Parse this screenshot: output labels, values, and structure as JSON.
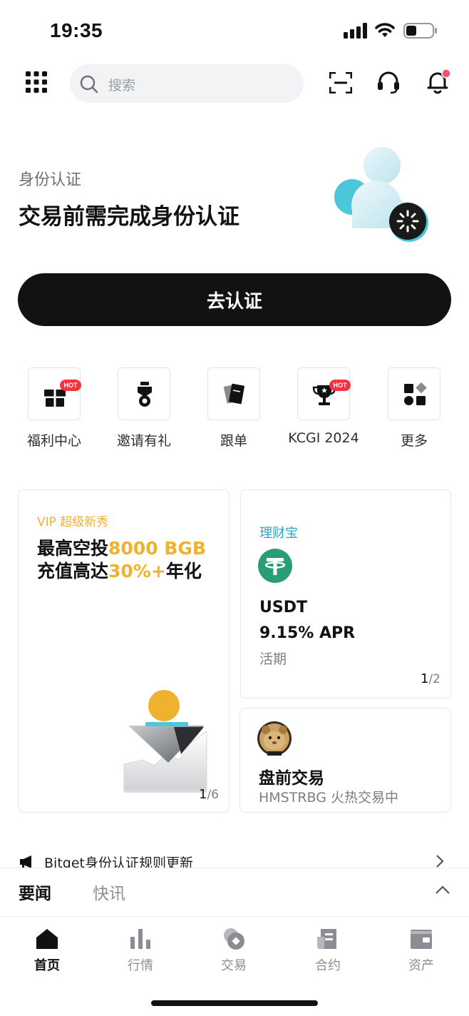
{
  "status_bar": {
    "time": "19:35",
    "icons": [
      "cellular-signal-icon",
      "wifi-icon",
      "battery-icon"
    ]
  },
  "top_bar": {
    "search_placeholder": "搜索",
    "icons": [
      "menu-grid-icon",
      "search-icon",
      "scan-icon",
      "support-headset-icon",
      "notification-bell-icon"
    ],
    "notification_dot_color": "#f0566b"
  },
  "kyc": {
    "label": "身份认证",
    "title": "交易前需完成身份认证",
    "button_label": "去认证",
    "button_color": "#121212"
  },
  "shortcuts": [
    {
      "label": "福利中心",
      "icon": "gift-icon",
      "badge": "HOT"
    },
    {
      "label": "邀请有礼",
      "icon": "medal-icon",
      "badge": ""
    },
    {
      "label": "跟单",
      "icon": "copy-trade-icon",
      "badge": ""
    },
    {
      "label": "KCGI 2024",
      "icon": "trophy-icon",
      "badge": "HOT"
    },
    {
      "label": "更多",
      "icon": "more-apps-icon",
      "badge": ""
    }
  ],
  "cards": {
    "vip": {
      "tag": "VIP 超级新秀",
      "line1_prefix": "最高空投",
      "line1_highlight": "8000 BGB",
      "line2_prefix": "充值高达",
      "line2_highlight": "30%+",
      "line2_suffix": "年化",
      "pager_current": "1",
      "pager_total": "/6",
      "highlight_color": "#f0b12f"
    },
    "earn": {
      "tag": "理财宝",
      "coin": "USDT",
      "apr": "9.15% APR",
      "term": "活期",
      "pager_current": "1",
      "pager_total": "/2",
      "tag_color": "#29a7c4",
      "coin_color": "#2a9d74"
    },
    "premarket": {
      "title": "盘前交易",
      "subtitle": "HMSTRBG 火热交易中"
    }
  },
  "announcement": {
    "text": "Bitget身份认证规则更新"
  },
  "news": {
    "tabs": [
      "要闻",
      "快讯"
    ],
    "active_tab": "要闻"
  },
  "bottom_nav": {
    "items": [
      {
        "label": "首页",
        "icon": "home-icon",
        "active": true
      },
      {
        "label": "行情",
        "icon": "markets-chart-icon",
        "active": false
      },
      {
        "label": "交易",
        "icon": "trade-icon",
        "active": false
      },
      {
        "label": "合约",
        "icon": "futures-contract-icon",
        "active": false
      },
      {
        "label": "资产",
        "icon": "assets-wallet-icon",
        "active": false
      }
    ]
  }
}
